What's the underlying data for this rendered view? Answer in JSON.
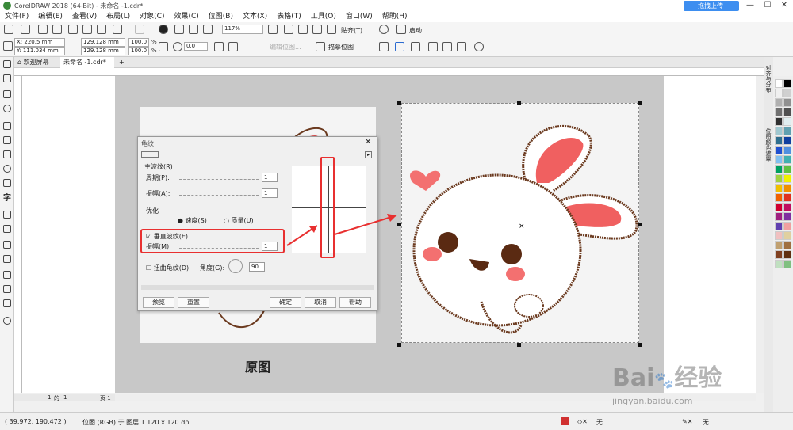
{
  "app": {
    "title": "CorelDRAW 2018 (64-Bit) - 未命名 -1.cdr*",
    "upload_label": "拖拽上传",
    "window_controls": [
      "—",
      "☐",
      "✕"
    ]
  },
  "menus": [
    "文件(F)",
    "编辑(E)",
    "查看(V)",
    "布局(L)",
    "对象(C)",
    "效果(C)",
    "位图(B)",
    "文本(X)",
    "表格(T)",
    "工具(O)",
    "窗口(W)",
    "帮助(H)"
  ],
  "toolbar": {
    "zoom": "117%",
    "snap_label": "贴齐(T)",
    "launch_label": "启动"
  },
  "propbar": {
    "x": "X: 220.5 mm",
    "y": "Y: 111.034 mm",
    "w": "129.128 mm",
    "h": "129.128 mm",
    "sx": "100.0",
    "sy": "100.0",
    "pct": "%",
    "rot": "0.0",
    "edit_bitmap": "编辑位图...",
    "trace_bitmap": "描摹位图"
  },
  "tabs": {
    "welcome": "欢迎屏幕",
    "doc": "未命名 -1.cdr*"
  },
  "canvas": {
    "caption": "原图"
  },
  "dialog": {
    "title": "龟纹",
    "main_wave": "主波纹(R)",
    "period_label": "周期(P):",
    "period_val": "1",
    "amp_label": "振幅(A):",
    "amp_val": "1",
    "optimize": "优化",
    "speed": "速度(S)",
    "quality": "质量(U)",
    "vertical_label": "垂直波纹(E)",
    "vamp_label": "振幅(M):",
    "vamp_val": "1",
    "twist": "扭曲龟纹(D)",
    "angle_label": "角度(G):",
    "angle_val": "90",
    "preview": "预览",
    "reset": "重置",
    "ok": "确定",
    "cancel": "取消",
    "help": "帮助"
  },
  "pagenav": {
    "page": "1",
    "of": "的",
    "total": "1",
    "page_tab": "页 1"
  },
  "docker": {
    "tab1": "对齐与分布",
    "tab2": "位图颜色遮罩"
  },
  "status": {
    "coords": "( 39.972, 190.472 )",
    "info": "位图 (RGB) 于 图层 1 120 x 120 dpi",
    "fill": "无",
    "outline": "无"
  },
  "watermark": {
    "brand": "Bai",
    "brand2": "经验",
    "url": "jingyan.baidu.com"
  },
  "palette": [
    "#ffffff",
    "#000000",
    "#f0f0f0",
    "#d0d0d0",
    "#b0b0b0",
    "#909090",
    "#707070",
    "#505050",
    "#303030",
    "#e0eef0",
    "#a0c8d0",
    "#60a0b0",
    "#2f6f8f",
    "#1040a0",
    "#2050d0",
    "#5090e0",
    "#80c0f0",
    "#40b0b0",
    "#00a060",
    "#60c040",
    "#a0d040",
    "#f0f000",
    "#f0c000",
    "#f09000",
    "#f06000",
    "#e03020",
    "#d00030",
    "#c01060",
    "#a02080",
    "#8030a0",
    "#6040b0",
    "#f0a0a0",
    "#f0c0c0",
    "#e0d0a0",
    "#c0a070",
    "#a07040",
    "#804020",
    "#603010",
    "#c0e0c0",
    "#80c080"
  ]
}
